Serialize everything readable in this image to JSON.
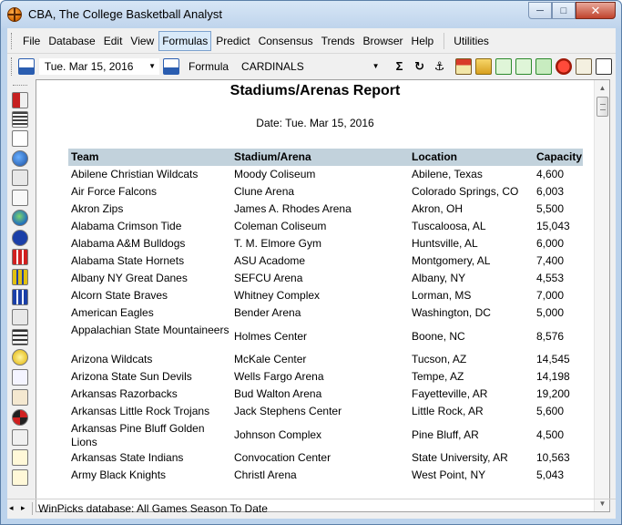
{
  "window": {
    "title": "CBA,  The College Basketball Analyst",
    "minimize_glyph": "─",
    "maximize_glyph": "□",
    "close_glyph": "✕"
  },
  "menu": {
    "items": [
      "File",
      "Database",
      "Edit",
      "View",
      "Formulas",
      "Predict",
      "Consensus",
      "Trends",
      "Browser",
      "Help"
    ],
    "extra": "Utilities",
    "active": "Formulas"
  },
  "toolbar": {
    "date_value": "Tue. Mar 15, 2016",
    "formula_label": "Formula",
    "formula_value": "CARDINALS",
    "dropdown_glyph": "▼",
    "sigma_glyph": "Σ",
    "refresh_glyph": "↻",
    "anchor_glyph": "⚓"
  },
  "report": {
    "title": "Stadiums/Arenas Report",
    "date_line": "Date: Tue. Mar 15, 2016",
    "columns": [
      "Team",
      "Stadium/Arena",
      "Location",
      "Capacity"
    ],
    "rows": [
      {
        "team": "Abilene Christian Wildcats",
        "stadium": "Moody Coliseum",
        "location": "Abilene, Texas",
        "capacity": "4,600"
      },
      {
        "team": "Air Force Falcons",
        "stadium": "Clune Arena",
        "location": "Colorado Springs, CO",
        "capacity": "6,003"
      },
      {
        "team": "Akron Zips",
        "stadium": "James A. Rhodes Arena",
        "location": "Akron, OH",
        "capacity": "5,500"
      },
      {
        "team": "Alabama Crimson Tide",
        "stadium": "Coleman Coliseum",
        "location": "Tuscaloosa, AL",
        "capacity": "15,043"
      },
      {
        "team": "Alabama A&M Bulldogs",
        "stadium": "T. M. Elmore Gym",
        "location": "Huntsville, AL",
        "capacity": "6,000"
      },
      {
        "team": "Alabama State Hornets",
        "stadium": "ASU Acadome",
        "location": "Montgomery, AL",
        "capacity": "7,400"
      },
      {
        "team": "Albany NY Great Danes",
        "stadium": "SEFCU Arena",
        "location": "Albany, NY",
        "capacity": "4,553"
      },
      {
        "team": "Alcorn State Braves",
        "stadium": "Whitney Complex",
        "location": "Lorman, MS",
        "capacity": "7,000"
      },
      {
        "team": "American Eagles",
        "stadium": "Bender Arena",
        "location": "Washington, DC",
        "capacity": "5,000"
      },
      {
        "team": "Appalachian State Mountaineers",
        "stadium": "Holmes Center",
        "location": "Boone, NC",
        "capacity": "8,576"
      },
      {
        "team": "Arizona Wildcats",
        "stadium": "McKale Center",
        "location": "Tucson, AZ",
        "capacity": "14,545"
      },
      {
        "team": "Arizona State Sun Devils",
        "stadium": "Wells Fargo Arena",
        "location": "Tempe, AZ",
        "capacity": "14,198"
      },
      {
        "team": "Arkansas Razorbacks",
        "stadium": "Bud Walton Arena",
        "location": "Fayetteville, AR",
        "capacity": "19,200"
      },
      {
        "team": "Arkansas Little Rock Trojans",
        "stadium": "Jack Stephens Center",
        "location": "Little Rock, AR",
        "capacity": "5,600"
      },
      {
        "team": "Arkansas Pine Bluff Golden Lions",
        "stadium": "Johnson Complex",
        "location": "Pine Bluff, AR",
        "capacity": "4,500"
      },
      {
        "team": "Arkansas State Indians",
        "stadium": "Convocation Center",
        "location": "State University, AR",
        "capacity": "10,563"
      },
      {
        "team": "Army Black Knights",
        "stadium": "Christl Arena",
        "location": "West Point, NY",
        "capacity": "5,043"
      }
    ]
  },
  "statusbar": {
    "text": "WinPicks database:  All Games Season To Date",
    "arrows": "◂ ▸"
  },
  "scrollbar": {
    "up_glyph": "▲",
    "down_glyph": "▼"
  },
  "colors": {
    "header_row": "#c2d2dc",
    "window_frame": "#bcd3ec",
    "close_button": "#c0432c"
  },
  "icons": {
    "toolbar": [
      "calendar-prev-icon",
      "calendar-next-icon",
      "sigma-icon",
      "refresh-icon",
      "anchor-icon",
      "home-icon",
      "open-folder-icon",
      "arrow-left-icon",
      "arrow-right-icon",
      "recycle-icon",
      "stop-icon",
      "person-icon",
      "ruler-icon"
    ],
    "sidebar": [
      "calculator-icon",
      "list-icon",
      "document-icon",
      "globe-icon",
      "function-icon",
      "music-icon",
      "earth-icon",
      "info-icon",
      "spreadsheet-red-icon",
      "spreadsheet-yellow-icon",
      "spreadsheet-blue-icon",
      "gears-icon",
      "bars-icon",
      "lightbulb-icon",
      "rpt-icon",
      "hand-icon",
      "wheel-icon",
      "chart-mo-icon",
      "clipboard-icon",
      "clipboard-star-icon"
    ]
  }
}
